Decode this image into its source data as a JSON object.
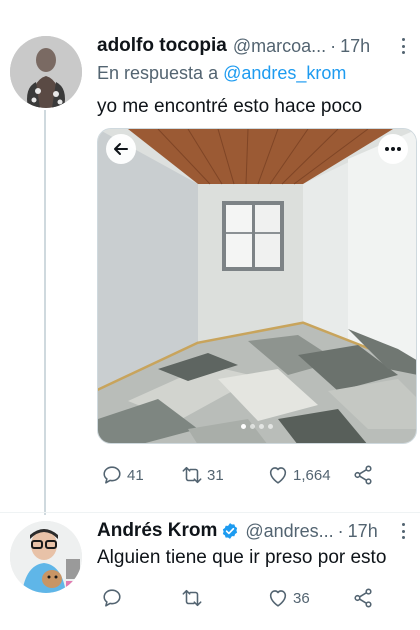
{
  "tweet1": {
    "name": "adolfo tocopia",
    "handle": "@marcoa...",
    "dot": "·",
    "time": "17h",
    "reply_prefix": "En respuesta a",
    "reply_mention": "@andres_krom",
    "text": "yo me encontré esto hace poco",
    "media": {
      "icon_back": "back-arrow-icon",
      "icon_more": "ellipsis-icon",
      "carousel_pages": 4,
      "carousel_active_index": 0
    },
    "stats": {
      "replies": "41",
      "retweets": "31",
      "likes": "1,664"
    }
  },
  "tweet2": {
    "name": "Andrés Krom",
    "handle": "@andres...",
    "dot": "·",
    "time": "17h",
    "verified": true,
    "text": "Alguien tiene que ir preso por esto",
    "stats": {
      "replies": "",
      "retweets": "",
      "likes": "36"
    }
  },
  "colors": {
    "accent": "#1d9bf0",
    "muted": "#536471",
    "text": "#0f1419",
    "verified": "#1d9bf0"
  }
}
